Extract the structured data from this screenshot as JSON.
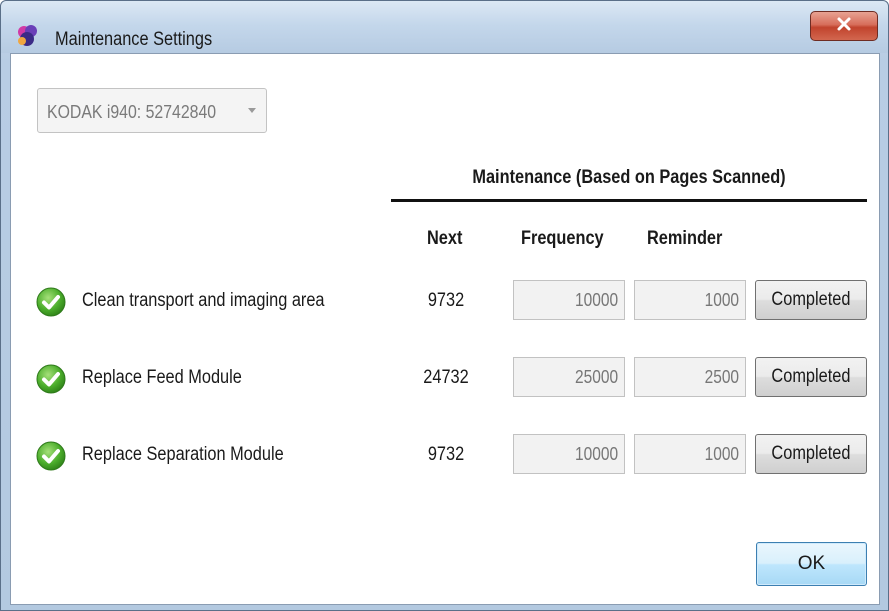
{
  "window": {
    "title": "Maintenance Settings",
    "close_glyph": "X"
  },
  "device_select": {
    "value": "KODAK i940: 52742840"
  },
  "section": {
    "title": "Maintenance (Based on Pages Scanned)"
  },
  "columns": {
    "next": "Next",
    "frequency": "Frequency",
    "reminder": "Reminder"
  },
  "tasks": [
    {
      "label": "Clean transport and imaging area",
      "next": "9732",
      "frequency": "10000",
      "reminder": "1000",
      "button": "Completed",
      "status_icon": "green-check-icon"
    },
    {
      "label": "Replace Feed Module",
      "next": "24732",
      "frequency": "25000",
      "reminder": "2500",
      "button": "Completed",
      "status_icon": "green-check-icon"
    },
    {
      "label": "Replace Separation Module",
      "next": "9732",
      "frequency": "10000",
      "reminder": "1000",
      "button": "Completed",
      "status_icon": "green-check-icon"
    }
  ],
  "footer": {
    "ok_label": "OK"
  },
  "colors": {
    "check_green": "#4cae2c",
    "close_red": "#c1432d",
    "ok_border": "#3c7fb1"
  }
}
